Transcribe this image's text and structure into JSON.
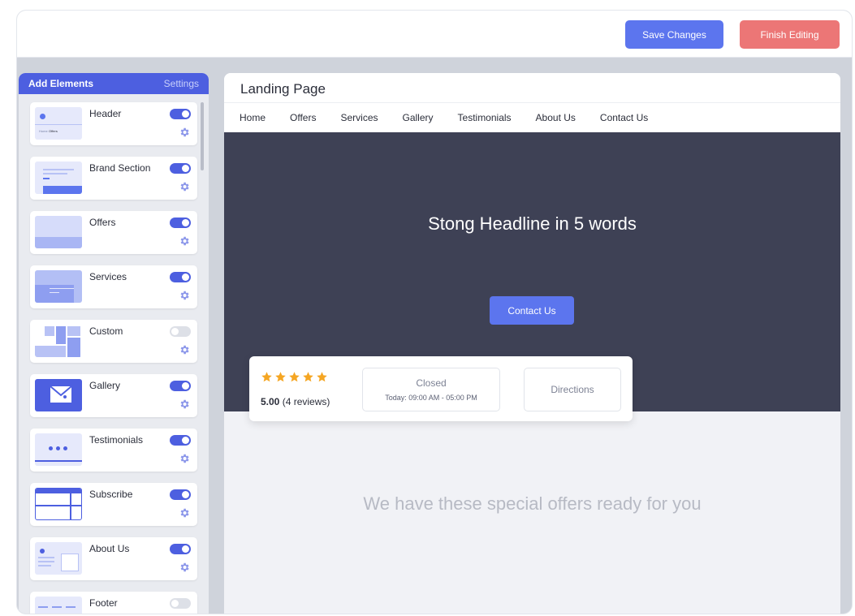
{
  "toolbar": {
    "save_label": "Save Changes",
    "finish_label": "Finish Editing"
  },
  "colors": {
    "accent": "#4d5fe0",
    "button_blue": "#5c75ee",
    "button_red": "#ec7676",
    "hero_bg": "#3e4155",
    "star": "#f5a623"
  },
  "sidebar": {
    "tab_active": "Add Elements",
    "tab_inactive": "Settings",
    "elements": [
      {
        "name": "Header",
        "enabled": true,
        "thumb_text_1": "Home",
        "thumb_text_2": "Offers"
      },
      {
        "name": "Brand Section",
        "enabled": true
      },
      {
        "name": "Offers",
        "enabled": true
      },
      {
        "name": "Services",
        "enabled": true
      },
      {
        "name": "Custom",
        "enabled": false
      },
      {
        "name": "Gallery",
        "enabled": true
      },
      {
        "name": "Testimonials",
        "enabled": true
      },
      {
        "name": "Subscribe",
        "enabled": true
      },
      {
        "name": "About Us",
        "enabled": true
      },
      {
        "name": "Footer",
        "enabled": false
      }
    ]
  },
  "preview": {
    "title": "Landing Page",
    "nav": [
      "Home",
      "Offers",
      "Services",
      "Gallery",
      "Testimonials",
      "About Us",
      "Contact Us"
    ],
    "hero": {
      "headline": "Stong Headline in 5 words",
      "cta": "Contact Us"
    },
    "info": {
      "stars": 5,
      "rating": "5.00",
      "reviews": "(4 reviews)",
      "status": "Closed",
      "hours": "Today: 09:00 AM - 05:00 PM",
      "directions": "Directions"
    },
    "offers_heading": "We have these special offers ready for you"
  }
}
